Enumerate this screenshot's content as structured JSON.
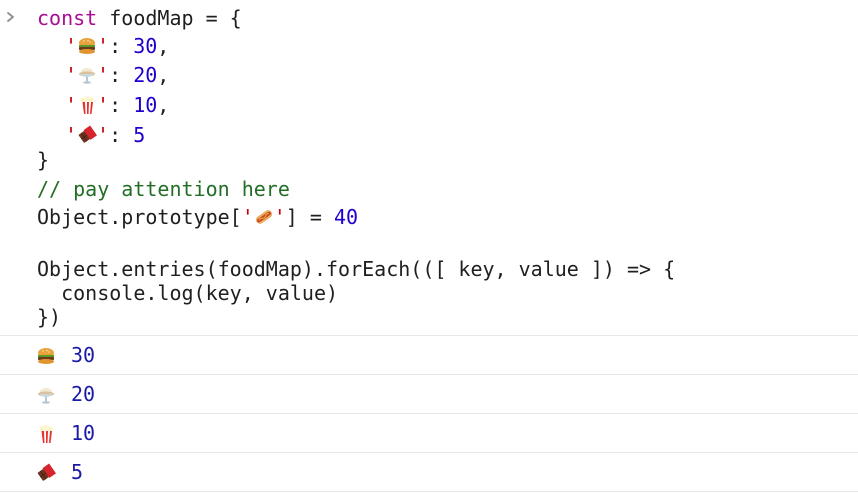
{
  "console": {
    "prompt_icon": "chevron-right-icon",
    "code": {
      "line1": {
        "kw": "const",
        "rest": " foodMap = {"
      },
      "line2": {
        "key_emoji": "hamburger-icon",
        "value": "30",
        "suffix": ","
      },
      "line3": {
        "key_emoji": "ice-cream-sundae-icon",
        "value": "20",
        "suffix": ","
      },
      "line4": {
        "key_emoji": "popcorn-icon",
        "value": "10",
        "suffix": ","
      },
      "line5": {
        "key_emoji": "chocolate-bar-icon",
        "value": "5",
        "suffix": ""
      },
      "line6": "}",
      "line7": "// pay attention here",
      "line8": {
        "prefix": "Object.prototype[",
        "emoji": "hot-dog-icon",
        "mid": "] = ",
        "value": "40"
      },
      "line9": "Object.entries(foodMap).forEach(([ key, value ]) => {",
      "line10": "  console.log(key, value)",
      "line11": "})"
    },
    "logs": [
      {
        "emoji": "hamburger-icon",
        "value": "30"
      },
      {
        "emoji": "ice-cream-sundae-icon",
        "value": "20"
      },
      {
        "emoji": "popcorn-icon",
        "value": "10"
      },
      {
        "emoji": "chocolate-bar-icon",
        "value": "5"
      }
    ]
  }
}
